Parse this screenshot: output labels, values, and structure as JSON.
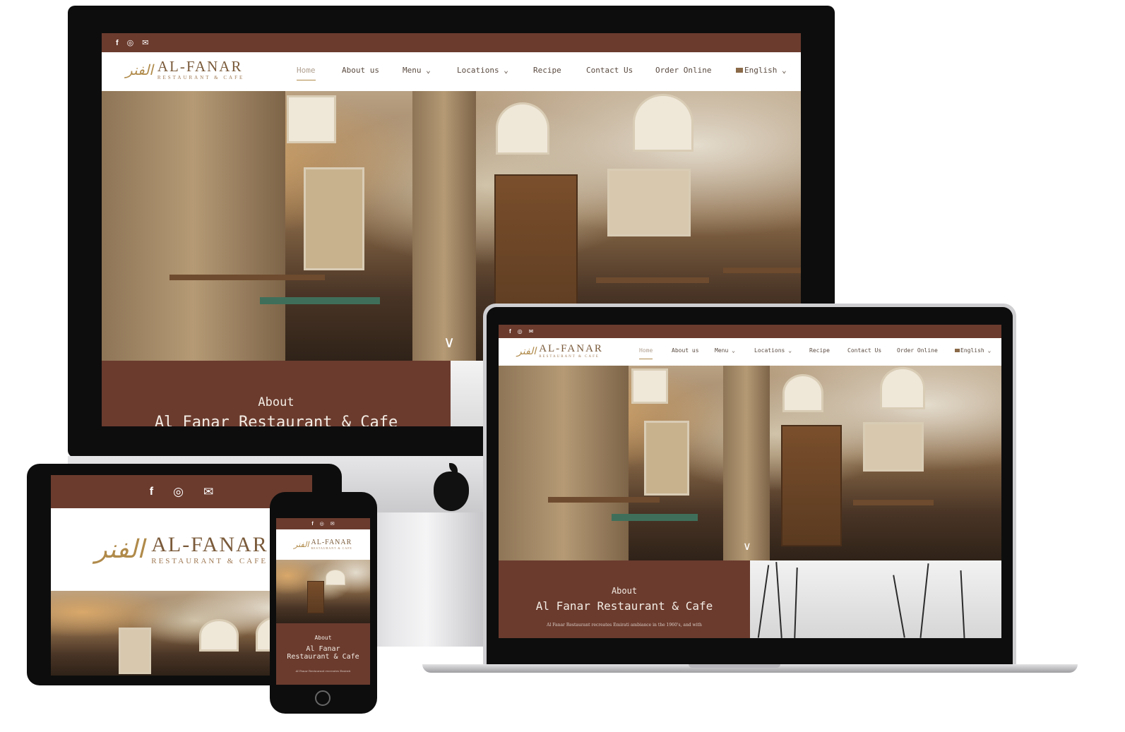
{
  "site": {
    "logo_arabic": "الفنر",
    "logo_title": "AL-FANAR",
    "logo_subtitle": "RESTAURANT & CAFE"
  },
  "nav": {
    "home": "Home",
    "about": "About us",
    "menu": "Menu",
    "locations": "Locations",
    "recipe": "Recipe",
    "contact": "Contact Us",
    "order": "Order Online",
    "language": "English"
  },
  "icons": {
    "facebook": "f",
    "instagram": "◎",
    "mail": "✉",
    "chevron": "⌄",
    "scroll": "∨",
    "apple": ""
  },
  "about": {
    "small": "About",
    "title": "Al Fanar Restaurant & Cafe",
    "title_phone_line1": "Al Fanar",
    "title_phone_line2": "Restaurant & Cafe",
    "text": "Al Fanar Restaurant recreates Emirati ambiance in the 1960's, and with",
    "text_phone": "Al Fanar Restaurant recreates Emirati"
  },
  "colors": {
    "brand": "#6b3b2e",
    "gold": "#b08a4a"
  }
}
